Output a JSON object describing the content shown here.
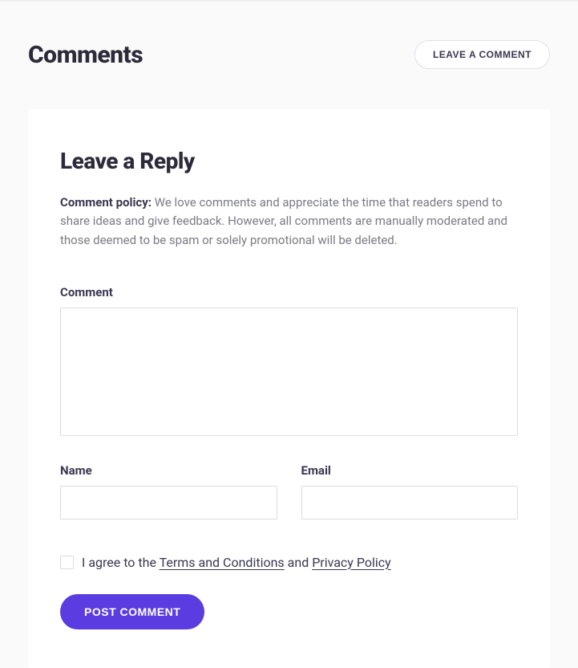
{
  "header": {
    "title": "Comments",
    "leave_button": "LEAVE A COMMENT"
  },
  "form": {
    "title": "Leave a Reply",
    "policy_label": "Comment policy:",
    "policy_text": " We love comments and appreciate the time that readers spend to share ideas and give feedback. However, all comments are manually moderated and those deemed to be spam or solely promotional will be deleted.",
    "comment_label": "Comment",
    "comment_value": "",
    "name_label": "Name",
    "name_value": "",
    "email_label": "Email",
    "email_value": "",
    "agree_prefix": "I agree to the ",
    "terms_link": "Terms and Conditions",
    "agree_mid": " and ",
    "privacy_link": "Privacy Policy",
    "submit_label": "POST COMMENT"
  }
}
